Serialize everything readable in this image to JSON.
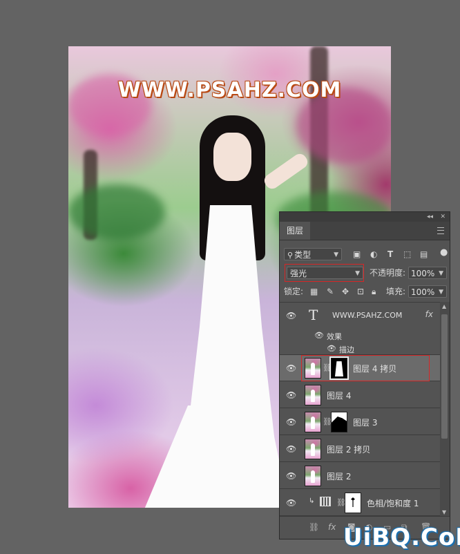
{
  "canvas": {
    "watermark": "WWW.PSAHZ.COM"
  },
  "panel": {
    "tab": "图层",
    "filter": {
      "label": "类型",
      "icons": [
        "image-filter-icon",
        "adjustment-filter-icon",
        "type-filter-icon",
        "shape-filter-icon",
        "smart-object-filter-icon"
      ]
    },
    "blend_mode": "强光",
    "opacity_label": "不透明度:",
    "opacity_value": "100%",
    "lock_label": "锁定:",
    "fill_label": "填充:",
    "fill_value": "100%",
    "layers": [
      {
        "name": "WWW.PSAHZ.COM",
        "type": "text",
        "fx": "fx",
        "effects_label": "效果",
        "effects": [
          "描边"
        ]
      },
      {
        "name": "图层 4 拷贝",
        "type": "pixel-with-mask",
        "selected": true
      },
      {
        "name": "图层 4",
        "type": "pixel"
      },
      {
        "name": "图层 3",
        "type": "pixel-with-mask"
      },
      {
        "name": "图层 2 拷贝",
        "type": "pixel"
      },
      {
        "name": "图层 2",
        "type": "pixel"
      },
      {
        "name": "色相/饱和度 1",
        "type": "adjustment",
        "clipped": true
      }
    ],
    "footer_fx": "fx"
  },
  "site_logo": "UiBQ.CoM",
  "colors": {
    "background": "#636363",
    "panel": "#535353",
    "highlight_red": "#d82626",
    "selected_row": "#6b6b6b"
  }
}
